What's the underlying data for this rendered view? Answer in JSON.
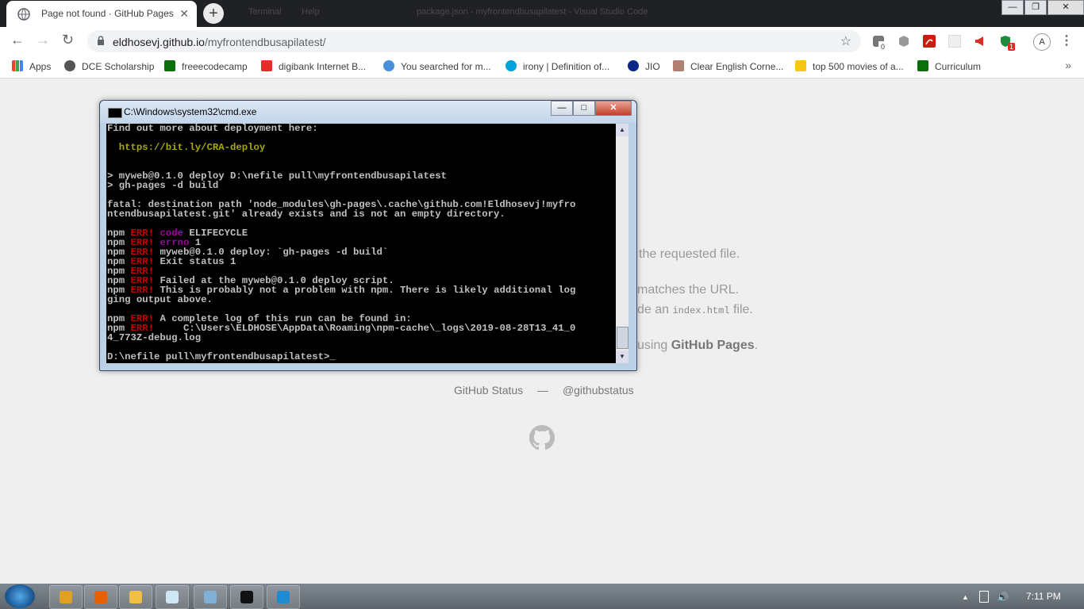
{
  "browser": {
    "tab_title": "Page not found · GitHub Pages",
    "tab_close": "✕",
    "new_tab": "+",
    "behind_window_title": "package.json - myfrontendbusapilatest - Visual Studio Code",
    "behind_menu": [
      "Terminal",
      "Help"
    ],
    "url_host": "eldhosevj.github.io",
    "url_path": "/myfrontendbusapilatest/",
    "back": "←",
    "forward": "→",
    "reload": "↻",
    "star": "☆",
    "avatar_letter": "A",
    "menu": "⋮",
    "ext_badge_0": "0",
    "ext_badge_1": "1",
    "win_min": "—",
    "win_max": "❐",
    "win_close": "✕"
  },
  "bookmarks": [
    {
      "label": "Apps",
      "icon": "apps-grid-icon",
      "color": "#4285f4"
    },
    {
      "label": "DCE Scholarship",
      "icon": "globe-icon",
      "color": "#555555"
    },
    {
      "label": "freeecodecamp",
      "icon": "freecodecamp-icon",
      "color": "#0a6e0a"
    },
    {
      "label": "digibank Internet B...",
      "icon": "digibank-icon",
      "color": "#e52d2d"
    },
    {
      "label": "You searched for m...",
      "icon": "edureka-icon",
      "color": "#4a8fd9"
    },
    {
      "label": "irony | Definition of...",
      "icon": "dictionary-icon",
      "color": "#00a3d9"
    },
    {
      "label": "JIO",
      "icon": "jio-icon",
      "color": "#0a2885"
    },
    {
      "label": "Clear English Corne...",
      "icon": "profile-photo-icon",
      "color": "#b08070"
    },
    {
      "label": "top 500 movies of a...",
      "icon": "imdb-icon",
      "color": "#f5c518"
    },
    {
      "label": "Curriculum",
      "icon": "freecodecamp-icon",
      "color": "#0a6e0a"
    }
  ],
  "bookmarks_more": "»",
  "page": {
    "line1": "the requested file.",
    "line2": "matches the URL.",
    "line3_pre": "de an ",
    "line3_code": "index.html",
    "line3_post": " file.",
    "line4_pre": "using ",
    "line4_bold": "GitHub Pages",
    "line4_post": ".",
    "footer_status": "GitHub Status",
    "footer_sep": "—",
    "footer_handle": "@githubstatus"
  },
  "cmd": {
    "title": "C:\\Windows\\system32\\cmd.exe",
    "min": "—",
    "max": "□",
    "close": "✕",
    "lines": [
      {
        "segments": [
          {
            "t": "Find out more about deployment here:",
            "c": ""
          }
        ]
      },
      {
        "segments": [
          {
            "t": "",
            "c": ""
          }
        ]
      },
      {
        "segments": [
          {
            "t": "  ",
            "c": ""
          },
          {
            "t": "https://bit.ly/CRA-deploy",
            "c": "y"
          }
        ]
      },
      {
        "segments": [
          {
            "t": "",
            "c": ""
          }
        ]
      },
      {
        "segments": [
          {
            "t": "",
            "c": ""
          }
        ]
      },
      {
        "segments": [
          {
            "t": "> myweb@0.1.0 deploy D:\\nefile pull\\myfrontendbusapilatest",
            "c": ""
          }
        ]
      },
      {
        "segments": [
          {
            "t": "> gh-pages -d build",
            "c": ""
          }
        ]
      },
      {
        "segments": [
          {
            "t": "",
            "c": ""
          }
        ]
      },
      {
        "segments": [
          {
            "t": "fatal: destination path 'node_modules\\gh-pages\\.cache\\github.com!Eldhosevj!myfro",
            "c": ""
          }
        ]
      },
      {
        "segments": [
          {
            "t": "ntendbusapilatest.git' already exists and is not an empty directory.",
            "c": ""
          }
        ]
      },
      {
        "segments": [
          {
            "t": "",
            "c": ""
          }
        ]
      },
      {
        "segments": [
          {
            "t": "npm ",
            "c": ""
          },
          {
            "t": "ERR!",
            "c": "r"
          },
          {
            "t": " ",
            "c": ""
          },
          {
            "t": "code",
            "c": "m"
          },
          {
            "t": " ELIFECYCLE",
            "c": ""
          }
        ]
      },
      {
        "segments": [
          {
            "t": "npm ",
            "c": ""
          },
          {
            "t": "ERR!",
            "c": "r"
          },
          {
            "t": " ",
            "c": ""
          },
          {
            "t": "errno",
            "c": "m"
          },
          {
            "t": " 1",
            "c": ""
          }
        ]
      },
      {
        "segments": [
          {
            "t": "npm ",
            "c": ""
          },
          {
            "t": "ERR!",
            "c": "r"
          },
          {
            "t": " myweb@0.1.0 deploy: `gh-pages -d build`",
            "c": ""
          }
        ]
      },
      {
        "segments": [
          {
            "t": "npm ",
            "c": ""
          },
          {
            "t": "ERR!",
            "c": "r"
          },
          {
            "t": " Exit status 1",
            "c": ""
          }
        ]
      },
      {
        "segments": [
          {
            "t": "npm ",
            "c": ""
          },
          {
            "t": "ERR!",
            "c": "r"
          }
        ]
      },
      {
        "segments": [
          {
            "t": "npm ",
            "c": ""
          },
          {
            "t": "ERR!",
            "c": "r"
          },
          {
            "t": " Failed at the myweb@0.1.0 deploy script.",
            "c": ""
          }
        ]
      },
      {
        "segments": [
          {
            "t": "npm ",
            "c": ""
          },
          {
            "t": "ERR!",
            "c": "r"
          },
          {
            "t": " This is probably not a problem with npm. There is likely additional log",
            "c": ""
          }
        ]
      },
      {
        "segments": [
          {
            "t": "ging output above.",
            "c": ""
          }
        ]
      },
      {
        "segments": [
          {
            "t": "",
            "c": ""
          }
        ]
      },
      {
        "segments": [
          {
            "t": "npm ",
            "c": ""
          },
          {
            "t": "ERR!",
            "c": "r"
          },
          {
            "t": " A complete log of this run can be found in:",
            "c": ""
          }
        ]
      },
      {
        "segments": [
          {
            "t": "npm ",
            "c": ""
          },
          {
            "t": "ERR!",
            "c": "r"
          },
          {
            "t": "     C:\\Users\\ELDHOSE\\AppData\\Roaming\\npm-cache\\_logs\\2019-08-28T13_41_0",
            "c": ""
          }
        ]
      },
      {
        "segments": [
          {
            "t": "4_773Z-debug.log",
            "c": ""
          }
        ]
      },
      {
        "segments": [
          {
            "t": "",
            "c": ""
          }
        ]
      },
      {
        "segments": [
          {
            "t": "D:\\nefile pull\\myfrontendbusapilatest>_",
            "c": ""
          }
        ]
      }
    ]
  },
  "taskbar": {
    "apps": [
      {
        "name": "chrome-taskbar-button",
        "color": "#e0a020"
      },
      {
        "name": "firefox-taskbar-button",
        "color": "#e66000"
      },
      {
        "name": "explorer-taskbar-button",
        "color": "#f0c040"
      },
      {
        "name": "notepad-taskbar-button",
        "color": "#cfe6f5"
      },
      {
        "name": "remote-desktop-taskbar-button",
        "color": "#7fb0d8"
      },
      {
        "name": "cmd-taskbar-button",
        "color": "#111111"
      },
      {
        "name": "vscode-taskbar-button",
        "color": "#1f8ad2"
      }
    ],
    "clock": "7:11 PM",
    "tray_arrow": "▲",
    "tray_volume": "🔊"
  }
}
